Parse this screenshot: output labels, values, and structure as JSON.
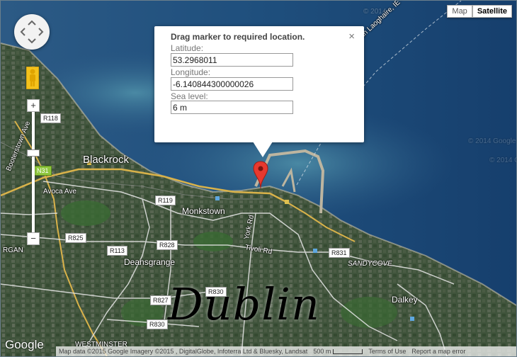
{
  "map_type": {
    "map_label": "Map",
    "satellite_label": "Satellite",
    "active": "Satellite"
  },
  "info_window": {
    "title": "Drag marker to required location.",
    "close_glyph": "×",
    "latitude_label": "Latitude:",
    "latitude_value": "53.2968011",
    "longitude_label": "Longitude:",
    "longitude_value": "-6.140844300000026",
    "sea_level_label": "Sea level:",
    "sea_level_value": "6 m"
  },
  "places": {
    "blackrock": "Blackrock",
    "monkstown": "Monkstown",
    "deansgrange": "Deansgrange",
    "dalkey": "Dalkey",
    "sandycove": "SANDYCOVE",
    "westminster": "WESTMINSTER",
    "rgan": "RGAN",
    "avoca_ave": "Avoca Ave",
    "booterstown_ave": "Booterstown Ave",
    "york_rd": "York Rd",
    "tivoli_rd": "Tivoli Rd",
    "ferry_route": "Dun Laoghaire, IE - Holyhead, G"
  },
  "shields": {
    "r118": "R118",
    "n31": "N31",
    "r119": "R119",
    "r825": "R825",
    "r828": "R828",
    "r113": "R113",
    "r830a": "R830",
    "r830b": "R830",
    "r827": "R827",
    "r831": "R831"
  },
  "overlay_text": "Dublin",
  "footer": {
    "google": "Google",
    "attribution": "Map data ©2015 Google Imagery ©2015 , DigitalGlobe, Infoterra Ltd & Bluesky, Landsat",
    "scale": "500 m",
    "terms": "Terms of Use",
    "report": "Report a map error"
  },
  "watermarks": [
    "© 2014",
    "© 2014 Google",
    "© 2014 Go"
  ],
  "colors": {
    "sea": "#1e4a7a",
    "land": "#3f5238",
    "marker": "#e8392f"
  },
  "icons": [
    "pan-icon",
    "pegman-icon",
    "zoom-in-icon",
    "zoom-out-icon",
    "marker-icon",
    "close-icon"
  ]
}
